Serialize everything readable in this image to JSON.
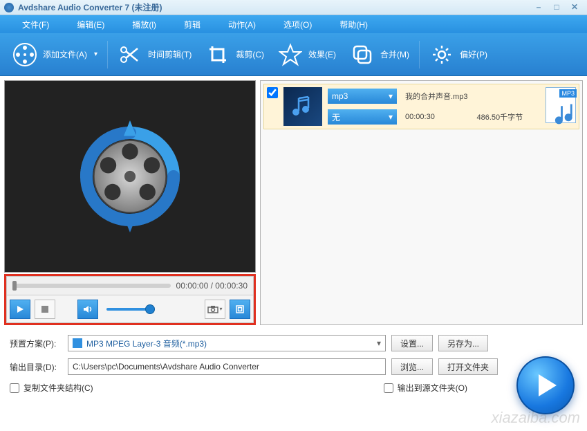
{
  "window": {
    "title": "Avdshare Audio Converter 7 (未注册)"
  },
  "menu": {
    "file": "文件(F)",
    "edit": "编辑(E)",
    "play": "播放(l)",
    "trim": "剪辑",
    "action": "动作(A)",
    "options": "选项(O)",
    "help": "帮助(H)"
  },
  "toolbar": {
    "add_file": "添加文件(A)",
    "time_trim": "时间剪辑(T)",
    "crop": "裁剪(C)",
    "effect": "效果(E)",
    "merge": "合并(M)",
    "preferences": "偏好(P)"
  },
  "player": {
    "current_time": "00:00:00",
    "total_time": "00:00:30",
    "time_sep": " / "
  },
  "file_list": {
    "items": [
      {
        "checked": true,
        "format_dropdown": "mp3",
        "source_dropdown": "无",
        "filename": "我的合并声音.mp3",
        "duration": "00:00:30",
        "filesize": "486.50千字节",
        "type_badge": "MP3"
      }
    ]
  },
  "settings": {
    "profile_label": "预置方案(P):",
    "profile_value": "MP3 MPEG Layer-3 音频(*.mp3)",
    "settings_btn": "设置...",
    "save_as_btn": "另存为...",
    "output_label": "输出目录(D):",
    "output_path": "C:\\Users\\pc\\Documents\\Avdshare Audio Converter",
    "browse_btn": "浏览...",
    "open_folder_btn": "打开文件夹",
    "copy_structure": "复制文件夹结构(C)",
    "output_to_source": "输出到源文件夹(O)"
  },
  "watermark": "xiazaiba.com"
}
